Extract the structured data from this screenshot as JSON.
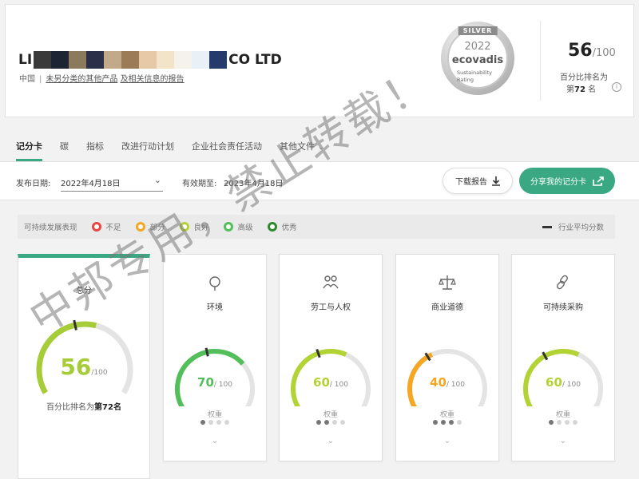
{
  "company": {
    "name_start": "LI",
    "name_end": "CO LTD",
    "country": "中国",
    "industry": "未另分类的其他产品",
    "link_text": "及相关信息的报告"
  },
  "medal": {
    "level": "SILVER",
    "year": "2022",
    "brand": "ecovadis",
    "line1": "Sustainability",
    "line2": "Rating"
  },
  "score_panel": {
    "score": "56",
    "of": "/100",
    "percentile_label": "百分比排名为",
    "rank_prefix": "第",
    "rank_value": "72",
    "rank_suffix": "名",
    "info_icon": "i"
  },
  "tabs": [
    {
      "label": "记分卡"
    },
    {
      "label": "碳"
    },
    {
      "label": "指标"
    },
    {
      "label": "改进行动计划"
    },
    {
      "label": "企业社会责任活动"
    },
    {
      "label": "其他文件"
    }
  ],
  "toolbar": {
    "publish_label": "发布日期:",
    "publish_date": "2022年4月18日",
    "valid_label": "有效期至:",
    "valid_date": "2023年4月18日",
    "download_label": "下载报告",
    "share_label": "分享我的记分卡"
  },
  "legend": {
    "title": "可持续发展表现",
    "items": [
      {
        "label": "不足",
        "color": "#e84545"
      },
      {
        "label": "部分",
        "color": "#f5a623"
      },
      {
        "label": "良好",
        "color": "#b3d334"
      },
      {
        "label": "高级",
        "color": "#52bf5a"
      },
      {
        "label": "优秀",
        "color": "#2f8a2f"
      }
    ],
    "avg_label": "行业平均分数"
  },
  "overall": {
    "title": "总分",
    "score": 56,
    "score_text": "56",
    "of": "/100",
    "rank_prefix": "百分比排名为",
    "rank_text": "第72名",
    "color": "#a6cc38",
    "industry_avg": 45
  },
  "categories": [
    {
      "title": "环境",
      "score": 70,
      "score_text": "70",
      "of": "/ 100",
      "color": "#52bf5a",
      "industry_avg": 45,
      "weight_label": "权重",
      "weight": 1,
      "icon": "leaf-icon"
    },
    {
      "title": "劳工与人权",
      "score": 60,
      "score_text": "60",
      "of": "/ 100",
      "color": "#b3d334",
      "industry_avg": 42,
      "weight_label": "权重",
      "weight": 2,
      "icon": "people-icon"
    },
    {
      "title": "商业道德",
      "score": 40,
      "score_text": "40",
      "of": "/ 100",
      "color": "#f5a623",
      "industry_avg": 37,
      "weight_label": "权重",
      "weight": 3,
      "icon": "scales-icon"
    },
    {
      "title": "可持续采购",
      "score": 60,
      "score_text": "60",
      "of": "/ 100",
      "color": "#b3d334",
      "industry_avg": 38,
      "weight_label": "权重",
      "weight": 1,
      "icon": "chain-icon"
    }
  ],
  "watermark": "中邦专用，禁止转载！",
  "colors": {
    "accent": "#3aa983",
    "track": "#e4e4e4",
    "marker": "#333333"
  }
}
